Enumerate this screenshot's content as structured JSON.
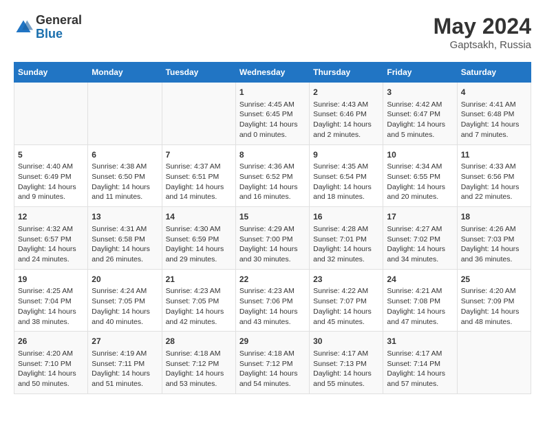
{
  "header": {
    "logo_general": "General",
    "logo_blue": "Blue",
    "month": "May 2024",
    "location": "Gaptsakh, Russia"
  },
  "weekdays": [
    "Sunday",
    "Monday",
    "Tuesday",
    "Wednesday",
    "Thursday",
    "Friday",
    "Saturday"
  ],
  "weeks": [
    [
      {
        "day": "",
        "sunrise": "",
        "sunset": "",
        "daylight": "",
        "empty": true
      },
      {
        "day": "",
        "sunrise": "",
        "sunset": "",
        "daylight": "",
        "empty": true
      },
      {
        "day": "",
        "sunrise": "",
        "sunset": "",
        "daylight": "",
        "empty": true
      },
      {
        "day": "1",
        "sunrise": "Sunrise: 4:45 AM",
        "sunset": "Sunset: 6:45 PM",
        "daylight": "Daylight: 14 hours and 0 minutes.",
        "empty": false
      },
      {
        "day": "2",
        "sunrise": "Sunrise: 4:43 AM",
        "sunset": "Sunset: 6:46 PM",
        "daylight": "Daylight: 14 hours and 2 minutes.",
        "empty": false
      },
      {
        "day": "3",
        "sunrise": "Sunrise: 4:42 AM",
        "sunset": "Sunset: 6:47 PM",
        "daylight": "Daylight: 14 hours and 5 minutes.",
        "empty": false
      },
      {
        "day": "4",
        "sunrise": "Sunrise: 4:41 AM",
        "sunset": "Sunset: 6:48 PM",
        "daylight": "Daylight: 14 hours and 7 minutes.",
        "empty": false
      }
    ],
    [
      {
        "day": "5",
        "sunrise": "Sunrise: 4:40 AM",
        "sunset": "Sunset: 6:49 PM",
        "daylight": "Daylight: 14 hours and 9 minutes.",
        "empty": false
      },
      {
        "day": "6",
        "sunrise": "Sunrise: 4:38 AM",
        "sunset": "Sunset: 6:50 PM",
        "daylight": "Daylight: 14 hours and 11 minutes.",
        "empty": false
      },
      {
        "day": "7",
        "sunrise": "Sunrise: 4:37 AM",
        "sunset": "Sunset: 6:51 PM",
        "daylight": "Daylight: 14 hours and 14 minutes.",
        "empty": false
      },
      {
        "day": "8",
        "sunrise": "Sunrise: 4:36 AM",
        "sunset": "Sunset: 6:52 PM",
        "daylight": "Daylight: 14 hours and 16 minutes.",
        "empty": false
      },
      {
        "day": "9",
        "sunrise": "Sunrise: 4:35 AM",
        "sunset": "Sunset: 6:54 PM",
        "daylight": "Daylight: 14 hours and 18 minutes.",
        "empty": false
      },
      {
        "day": "10",
        "sunrise": "Sunrise: 4:34 AM",
        "sunset": "Sunset: 6:55 PM",
        "daylight": "Daylight: 14 hours and 20 minutes.",
        "empty": false
      },
      {
        "day": "11",
        "sunrise": "Sunrise: 4:33 AM",
        "sunset": "Sunset: 6:56 PM",
        "daylight": "Daylight: 14 hours and 22 minutes.",
        "empty": false
      }
    ],
    [
      {
        "day": "12",
        "sunrise": "Sunrise: 4:32 AM",
        "sunset": "Sunset: 6:57 PM",
        "daylight": "Daylight: 14 hours and 24 minutes.",
        "empty": false
      },
      {
        "day": "13",
        "sunrise": "Sunrise: 4:31 AM",
        "sunset": "Sunset: 6:58 PM",
        "daylight": "Daylight: 14 hours and 26 minutes.",
        "empty": false
      },
      {
        "day": "14",
        "sunrise": "Sunrise: 4:30 AM",
        "sunset": "Sunset: 6:59 PM",
        "daylight": "Daylight: 14 hours and 29 minutes.",
        "empty": false
      },
      {
        "day": "15",
        "sunrise": "Sunrise: 4:29 AM",
        "sunset": "Sunset: 7:00 PM",
        "daylight": "Daylight: 14 hours and 30 minutes.",
        "empty": false
      },
      {
        "day": "16",
        "sunrise": "Sunrise: 4:28 AM",
        "sunset": "Sunset: 7:01 PM",
        "daylight": "Daylight: 14 hours and 32 minutes.",
        "empty": false
      },
      {
        "day": "17",
        "sunrise": "Sunrise: 4:27 AM",
        "sunset": "Sunset: 7:02 PM",
        "daylight": "Daylight: 14 hours and 34 minutes.",
        "empty": false
      },
      {
        "day": "18",
        "sunrise": "Sunrise: 4:26 AM",
        "sunset": "Sunset: 7:03 PM",
        "daylight": "Daylight: 14 hours and 36 minutes.",
        "empty": false
      }
    ],
    [
      {
        "day": "19",
        "sunrise": "Sunrise: 4:25 AM",
        "sunset": "Sunset: 7:04 PM",
        "daylight": "Daylight: 14 hours and 38 minutes.",
        "empty": false
      },
      {
        "day": "20",
        "sunrise": "Sunrise: 4:24 AM",
        "sunset": "Sunset: 7:05 PM",
        "daylight": "Daylight: 14 hours and 40 minutes.",
        "empty": false
      },
      {
        "day": "21",
        "sunrise": "Sunrise: 4:23 AM",
        "sunset": "Sunset: 7:05 PM",
        "daylight": "Daylight: 14 hours and 42 minutes.",
        "empty": false
      },
      {
        "day": "22",
        "sunrise": "Sunrise: 4:23 AM",
        "sunset": "Sunset: 7:06 PM",
        "daylight": "Daylight: 14 hours and 43 minutes.",
        "empty": false
      },
      {
        "day": "23",
        "sunrise": "Sunrise: 4:22 AM",
        "sunset": "Sunset: 7:07 PM",
        "daylight": "Daylight: 14 hours and 45 minutes.",
        "empty": false
      },
      {
        "day": "24",
        "sunrise": "Sunrise: 4:21 AM",
        "sunset": "Sunset: 7:08 PM",
        "daylight": "Daylight: 14 hours and 47 minutes.",
        "empty": false
      },
      {
        "day": "25",
        "sunrise": "Sunrise: 4:20 AM",
        "sunset": "Sunset: 7:09 PM",
        "daylight": "Daylight: 14 hours and 48 minutes.",
        "empty": false
      }
    ],
    [
      {
        "day": "26",
        "sunrise": "Sunrise: 4:20 AM",
        "sunset": "Sunset: 7:10 PM",
        "daylight": "Daylight: 14 hours and 50 minutes.",
        "empty": false
      },
      {
        "day": "27",
        "sunrise": "Sunrise: 4:19 AM",
        "sunset": "Sunset: 7:11 PM",
        "daylight": "Daylight: 14 hours and 51 minutes.",
        "empty": false
      },
      {
        "day": "28",
        "sunrise": "Sunrise: 4:18 AM",
        "sunset": "Sunset: 7:12 PM",
        "daylight": "Daylight: 14 hours and 53 minutes.",
        "empty": false
      },
      {
        "day": "29",
        "sunrise": "Sunrise: 4:18 AM",
        "sunset": "Sunset: 7:12 PM",
        "daylight": "Daylight: 14 hours and 54 minutes.",
        "empty": false
      },
      {
        "day": "30",
        "sunrise": "Sunrise: 4:17 AM",
        "sunset": "Sunset: 7:13 PM",
        "daylight": "Daylight: 14 hours and 55 minutes.",
        "empty": false
      },
      {
        "day": "31",
        "sunrise": "Sunrise: 4:17 AM",
        "sunset": "Sunset: 7:14 PM",
        "daylight": "Daylight: 14 hours and 57 minutes.",
        "empty": false
      },
      {
        "day": "",
        "sunrise": "",
        "sunset": "",
        "daylight": "",
        "empty": true
      }
    ]
  ]
}
